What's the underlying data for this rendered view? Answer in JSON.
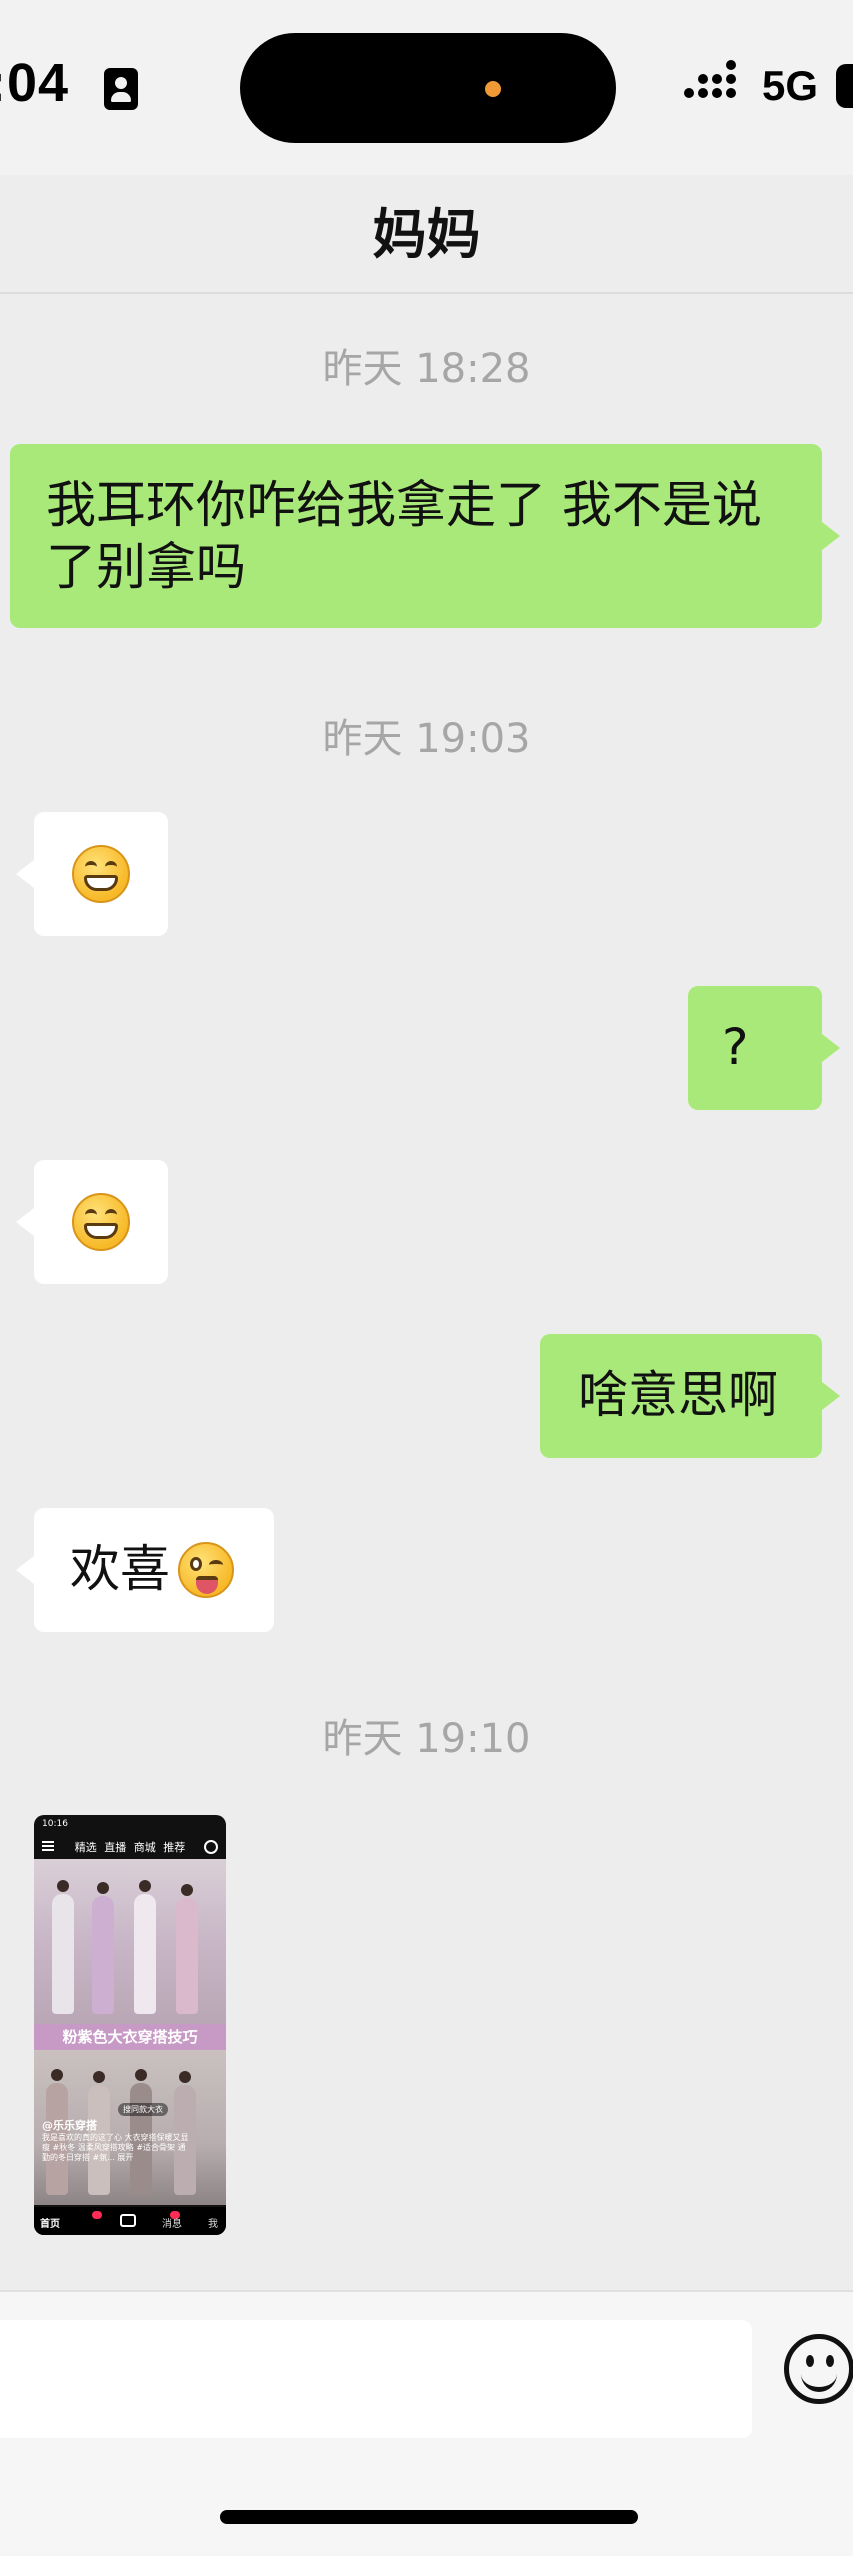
{
  "status_bar": {
    "time": ":04",
    "network": "5G"
  },
  "chat": {
    "title": "妈妈",
    "timestamps": [
      "昨天 18:28",
      "昨天 19:03",
      "昨天 19:10"
    ],
    "messages": [
      {
        "sender": "me",
        "text_lines": [
          "我耳环你咋给我拿走了 我不是说",
          "了别拿吗"
        ]
      },
      {
        "sender": "mom",
        "emoji": "grinning-face-icon"
      },
      {
        "sender": "me",
        "text": "?"
      },
      {
        "sender": "mom",
        "emoji": "grinning-face-icon"
      },
      {
        "sender": "me",
        "text": "啥意思啊"
      },
      {
        "sender": "mom",
        "text": "欢喜",
        "emoji": "winking-tongue-face-icon"
      }
    ]
  },
  "shared_video": {
    "status_time": "10:16",
    "tabs": "精选 直播 商城 推荐",
    "banner": "粉紫色大衣穿搭技巧",
    "search_chip": "搜同款大衣",
    "author": "@乐乐穿搭",
    "caption": "我是喜欢的真的这了心 大衣穿搭保暖又显瘦 #秋冬 温柔风穿搭攻略 #适合骨架 通勤的冬日穿搭 #氛... 展开",
    "nav": {
      "home": "首页",
      "messages": "消息",
      "me": "我"
    }
  },
  "colors": {
    "sent_bubble": "#a9e97a",
    "received_bubble": "#ffffff",
    "background": "#ededed"
  }
}
